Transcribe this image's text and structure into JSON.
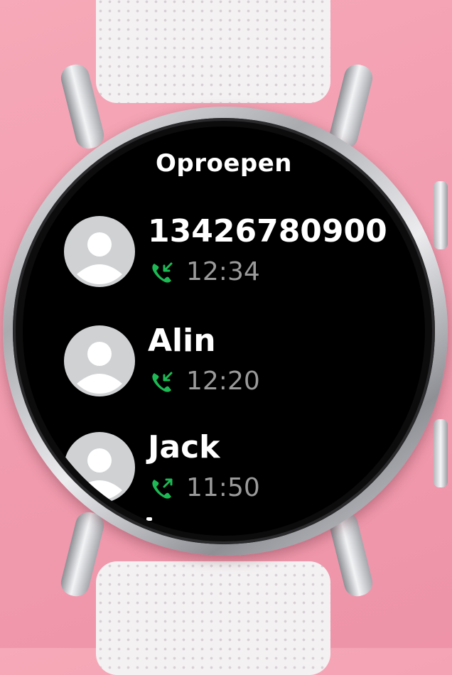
{
  "screen": {
    "title": "Oproepen"
  },
  "calls": [
    {
      "contact": "13426780900",
      "time": "12:34",
      "direction": "incoming",
      "icon": "incoming-call-icon"
    },
    {
      "contact": "Alin",
      "time": "12:20",
      "direction": "incoming",
      "icon": "incoming-call-icon"
    },
    {
      "contact": "Jack",
      "time": "11:50",
      "direction": "outgoing",
      "icon": "outgoing-call-icon"
    }
  ],
  "colors": {
    "call_icon": "#1db954",
    "avatar_bg": "#cfd1d3",
    "time_text": "#9a9a9a",
    "background": "#f29db0"
  }
}
